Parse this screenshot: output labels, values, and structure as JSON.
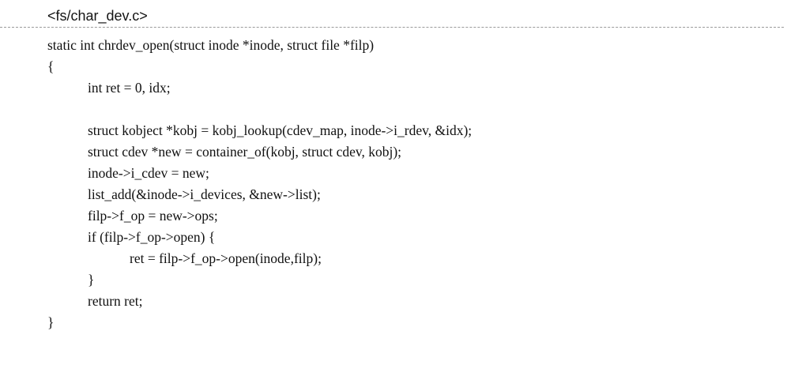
{
  "document": {
    "filename": "<fs/char_dev.c>",
    "code_lines": [
      {
        "text": "static int chrdev_open(struct inode *inode, struct file *filp)",
        "indent": 0
      },
      {
        "text": "{",
        "indent": 0
      },
      {
        "text": "int ret = 0, idx;",
        "indent": 1
      },
      {
        "text": "",
        "indent": 1
      },
      {
        "text": "struct kobject *kobj = kobj_lookup(cdev_map, inode->i_rdev, &idx);",
        "indent": 1
      },
      {
        "text": "struct cdev *new = container_of(kobj, struct cdev, kobj);",
        "indent": 1
      },
      {
        "text": "inode->i_cdev = new;",
        "indent": 1
      },
      {
        "text": "list_add(&inode->i_devices, &new->list);",
        "indent": 1
      },
      {
        "text": "filp->f_op = new->ops;",
        "indent": 1
      },
      {
        "text": "if (filp->f_op->open) {",
        "indent": 1
      },
      {
        "text": "ret = filp->f_op->open(inode,filp);",
        "indent": 2
      },
      {
        "text": "}",
        "indent": 1
      },
      {
        "text": "return ret;",
        "indent": 1
      },
      {
        "text": "}",
        "indent": 0
      }
    ]
  }
}
